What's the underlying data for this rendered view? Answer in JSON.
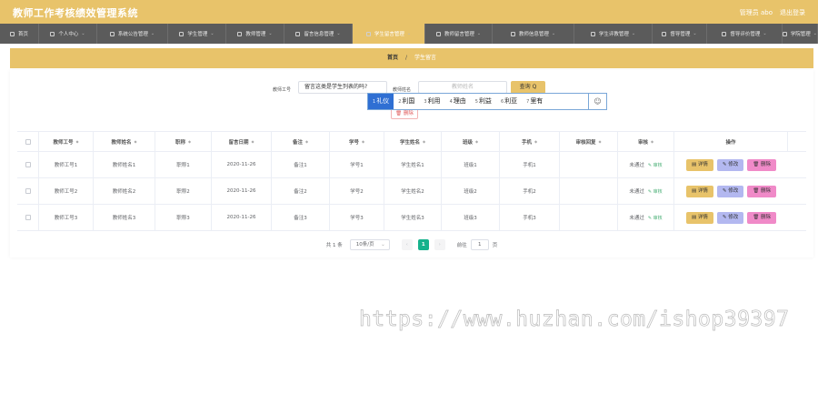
{
  "header": {
    "title": "教师工作考核绩效管理系统",
    "user": "管理员 abo",
    "logout": "退出登录"
  },
  "nav": {
    "items": [
      {
        "label": "首页",
        "has_menu": false
      },
      {
        "label": "个人中心",
        "has_menu": true
      },
      {
        "label": "系统公告管理",
        "has_menu": true
      },
      {
        "label": "学生管理",
        "has_menu": true
      },
      {
        "label": "教师管理",
        "has_menu": true
      },
      {
        "label": "留言信息管理",
        "has_menu": true
      },
      {
        "label": "学生留言管理",
        "has_menu": true,
        "active": true
      },
      {
        "label": "教师留言管理",
        "has_menu": true
      },
      {
        "label": "教师信息管理",
        "has_menu": true
      },
      {
        "label": "学生评教管理",
        "has_menu": true
      },
      {
        "label": "督导管理",
        "has_menu": true
      },
      {
        "label": "督导评价管理",
        "has_menu": true
      },
      {
        "label": "学院管理",
        "has_menu": true
      }
    ]
  },
  "breadcrumb": {
    "home": "首页",
    "separator": "/",
    "current": "学生留言"
  },
  "search": {
    "teacher_no_label": "教师工号",
    "teacher_no_value": "留言这类是学生列表的吗?",
    "teacher_name_label": "教师姓名",
    "teacher_name_placeholder": "教师姓名",
    "query_button": "查询 Q",
    "delete_button": "删除"
  },
  "ime": {
    "candidates": [
      {
        "n": "1",
        "text": "礼仪"
      },
      {
        "n": "2",
        "text": "利国"
      },
      {
        "n": "3",
        "text": "利用"
      },
      {
        "n": "4",
        "text": "理由"
      },
      {
        "n": "5",
        "text": "利益"
      },
      {
        "n": "6",
        "text": "利亚"
      },
      {
        "n": "7",
        "text": "里有"
      }
    ],
    "emoji": "☺"
  },
  "table": {
    "columns": [
      "教师工号",
      "教师姓名",
      "职称",
      "留言日期",
      "备注",
      "学号",
      "学生姓名",
      "班级",
      "手机",
      "审核回复",
      "审核",
      "操作"
    ],
    "rows": [
      {
        "teacher_no": "教师工号1",
        "teacher_name": "教师姓名1",
        "title": "职称1",
        "date": "2020-11-26",
        "note": "备注1",
        "student_no": "学号1",
        "student_name": "学生姓名1",
        "class": "班级1",
        "phone": "手机1",
        "reply": "",
        "status": "未通过",
        "review": "审核"
      },
      {
        "teacher_no": "教师工号2",
        "teacher_name": "教师姓名2",
        "title": "职称2",
        "date": "2020-11-26",
        "note": "备注2",
        "student_no": "学号2",
        "student_name": "学生姓名2",
        "class": "班级2",
        "phone": "手机2",
        "reply": "",
        "status": "未通过",
        "review": "审核"
      },
      {
        "teacher_no": "教师工号3",
        "teacher_name": "教师姓名3",
        "title": "职称3",
        "date": "2020-11-26",
        "note": "备注3",
        "student_no": "学号3",
        "student_name": "学生姓名3",
        "class": "班级3",
        "phone": "手机3",
        "reply": "",
        "status": "未通过",
        "review": "审核"
      }
    ],
    "actions": {
      "detail": "详情",
      "edit": "修改",
      "delete": "删除"
    }
  },
  "pagination": {
    "total": "共 1 条",
    "page_size": "10条/页",
    "current_page": "1",
    "goto_label": "前往",
    "goto_value": "1",
    "page_unit": "页"
  },
  "watermark": "https://www.huzhan.com/ishop39397",
  "colors": {
    "accent": "#e8c36a",
    "nav_bg": "#5b5b5b",
    "edit_button": "#b3b8f0",
    "delete_button": "#f08ac8",
    "page_active": "#16b28c"
  }
}
